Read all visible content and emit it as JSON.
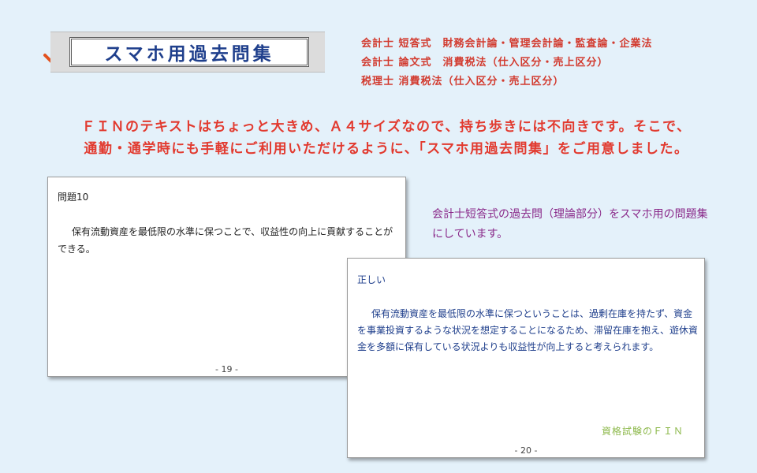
{
  "banner": {
    "title": "スマホ用過去問集",
    "check_icon_color": "#e2521f"
  },
  "subjects": [
    "会計士 短答式　財務会計論・管理会計論・監査論・企業法",
    "会計士 論文式　消費税法（仕入区分・売上区分）",
    "税理士 消費税法（仕入区分・売上区分）"
  ],
  "intro": {
    "line1": "ＦＩＮのテキストはちょっと大きめ、Ａ４サイズなので、持ち歩きには不向きです。そこで、",
    "line2": "通勤・通学時にも手軽にご利用いただけるように、「スマホ用過去問集」をご用意しました。"
  },
  "question_card": {
    "number": "問題10",
    "text": "保有流動資産を最低限の水準に保つことで、収益性の向上に貢献することができる。",
    "page": "- 19 -"
  },
  "answer_card": {
    "verdict": "正しい",
    "text": "保有流動資産を最低限の水準に保つということは、過剰在庫を持たず、資金を事業投資するような状況を想定することになるため、滞留在庫を抱え、遊休資金を多額に保有している状況よりも収益性が向上すると考えられます。",
    "brand": "資格試験のＦＩＮ",
    "page": "- 20 -"
  },
  "description": "会計士短答式の過去問（理論部分）をスマホ用の問題集にしています。",
  "colors": {
    "background": "#e4f1fa",
    "accent_red": "#e23a2f",
    "title_blue": "#1f3f8c",
    "description_purple": "#8a2a8a",
    "brand_green": "#8cb84a"
  }
}
